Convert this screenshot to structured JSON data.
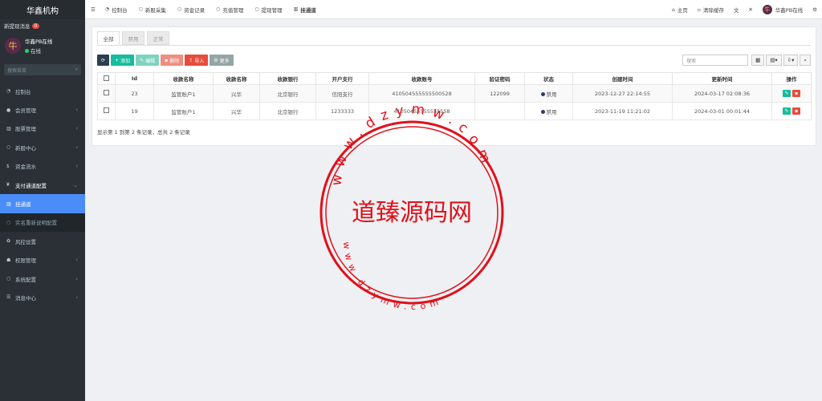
{
  "brand": "华鑫机构",
  "notice": {
    "label": "新提现消息",
    "count": "0"
  },
  "user": {
    "name": "华鑫PB在线",
    "status": "在线",
    "avatar_char": "牛"
  },
  "sidebar": {
    "search_placeholder": "搜索菜单",
    "items": [
      {
        "label": "控制台",
        "icon": "dashboard-icon"
      },
      {
        "label": "会员管理",
        "icon": "user-icon"
      },
      {
        "label": "股票管理",
        "icon": "bank-icon"
      },
      {
        "label": "新股中心",
        "icon": "circle-icon"
      },
      {
        "label": "资金流水",
        "icon": "dollar-icon"
      },
      {
        "label": "支付通道配置",
        "icon": "yen-icon"
      },
      {
        "label": "挂通道",
        "icon": "bank-icon"
      },
      {
        "label": "实名重新说明配置",
        "icon": "circle-icon"
      },
      {
        "label": "风控设置",
        "icon": "gear-icon"
      },
      {
        "label": "权限管理",
        "icon": "users-icon"
      },
      {
        "label": "系统配置",
        "icon": "circle-icon"
      },
      {
        "label": "消息中心",
        "icon": "list-icon"
      }
    ]
  },
  "topbar": {
    "tabs": [
      "控制台",
      "新股采集",
      "资金记录",
      "充值管理",
      "提现管理",
      "挂通道"
    ],
    "right": {
      "home": "主页",
      "clear": "清除缓存",
      "user": "华鑫PB在线"
    }
  },
  "panel": {
    "tabs": [
      "全部",
      "禁用",
      "正常"
    ],
    "toolbar": {
      "add": "添加",
      "edit": "编辑",
      "delete": "删除",
      "import": "导入",
      "more": "更多"
    },
    "search_placeholder": "搜索",
    "columns": [
      "Id",
      "收款名称",
      "收款名称",
      "收款银行",
      "开户支行",
      "收款账号",
      "验证密码",
      "状态",
      "创建时间",
      "更新时间",
      "操作"
    ],
    "rows": [
      [
        "23",
        "监管账户1",
        "兴华",
        "北京银行",
        "信阳支行",
        "410504555555500528",
        "122099",
        "禁用",
        "2023-12-27 22:14:55",
        "2024-03-17 02:08:36"
      ],
      [
        "19",
        "监管账户1",
        "兴华",
        "北京银行",
        "1233333",
        "41050455555555558",
        "",
        "禁用",
        "2023-11-19 11:21:02",
        "2024-03-01 00:01:44"
      ]
    ],
    "footer": "显示第 1 到第 2 条记录，总共 2 条记录"
  },
  "watermark": {
    "title": "道臻源码网",
    "top_text": "www.dzymw.com",
    "bottom_text": "www.dzymw.com"
  },
  "colors": {
    "add": "#18bc9c",
    "edit": "#7ed3c0",
    "delete": "#f08d7f",
    "import": "#e74c3c",
    "more": "#95a5a6",
    "refresh": "#2c3e50",
    "seal": "#e0101a"
  }
}
